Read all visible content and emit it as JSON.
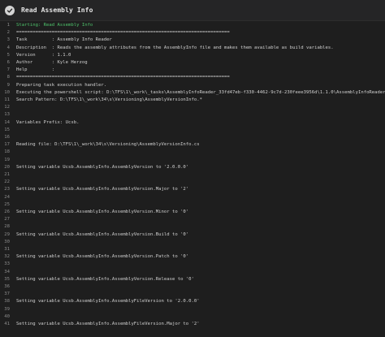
{
  "header": {
    "title": "Read Assembly Info",
    "status_icon": "check-icon"
  },
  "log": [
    {
      "n": "1",
      "t": "Starting: Read Assembly Info",
      "green": true
    },
    {
      "n": "2",
      "t": "=============================================================================="
    },
    {
      "n": "3",
      "t": "Task         : Assembly Info Reader"
    },
    {
      "n": "4",
      "t": "Description  : Reads the assembly attributes from the AssemblyInfo file and makes them available as build variables."
    },
    {
      "n": "5",
      "t": "Version      : 1.1.0"
    },
    {
      "n": "6",
      "t": "Author       : Kyle Herzog"
    },
    {
      "n": "7",
      "t": "Help         : "
    },
    {
      "n": "8",
      "t": "=============================================================================="
    },
    {
      "n": "9",
      "t": "Preparing task execution handler."
    },
    {
      "n": "10",
      "t": "Executing the powershell script: D:\\TFS\\1\\_work\\_tasks\\AssemblyInfoReader_33fd47eb-f330-4462-9c7d-230feee3956d\\1.1.0\\AssemblyInfoReader.ps1"
    },
    {
      "n": "11",
      "t": "Search Pattern: D:\\TFS\\1\\_work\\34\\s\\Versioning\\AssemblyVersionInfo.*"
    },
    {
      "n": "12",
      "t": ""
    },
    {
      "n": "13",
      "t": ""
    },
    {
      "n": "14",
      "t": "Variables Prefix: Ucsb."
    },
    {
      "n": "15",
      "t": ""
    },
    {
      "n": "16",
      "t": ""
    },
    {
      "n": "17",
      "t": "Reading file: D:\\TFS\\1\\_work\\34\\s\\Versioning\\AssemblyVersionInfo.cs"
    },
    {
      "n": "18",
      "t": ""
    },
    {
      "n": "19",
      "t": ""
    },
    {
      "n": "20",
      "t": "Setting variable Ucsb.AssemblyInfo.AssemblyVersion to '2.0.0.0'"
    },
    {
      "n": "21",
      "t": ""
    },
    {
      "n": "22",
      "t": ""
    },
    {
      "n": "23",
      "t": "Setting variable Ucsb.AssemblyInfo.AssemblyVersion.Major to '2'"
    },
    {
      "n": "24",
      "t": ""
    },
    {
      "n": "25",
      "t": ""
    },
    {
      "n": "26",
      "t": "Setting variable Ucsb.AssemblyInfo.AssemblyVersion.Minor to '0'"
    },
    {
      "n": "27",
      "t": ""
    },
    {
      "n": "28",
      "t": ""
    },
    {
      "n": "29",
      "t": "Setting variable Ucsb.AssemblyInfo.AssemblyVersion.Build to '0'"
    },
    {
      "n": "30",
      "t": ""
    },
    {
      "n": "31",
      "t": ""
    },
    {
      "n": "32",
      "t": "Setting variable Ucsb.AssemblyInfo.AssemblyVersion.Patch to '0'"
    },
    {
      "n": "33",
      "t": ""
    },
    {
      "n": "34",
      "t": ""
    },
    {
      "n": "35",
      "t": "Setting variable Ucsb.AssemblyInfo.AssemblyVersion.Release to '0'"
    },
    {
      "n": "36",
      "t": ""
    },
    {
      "n": "37",
      "t": ""
    },
    {
      "n": "38",
      "t": "Setting variable Ucsb.AssemblyInfo.AssemblyFileVersion to '2.0.0.0'"
    },
    {
      "n": "39",
      "t": ""
    },
    {
      "n": "40",
      "t": ""
    },
    {
      "n": "41",
      "t": "Setting variable Ucsb.AssemblyInfo.AssemblyFileVersion.Major to '2'"
    }
  ]
}
